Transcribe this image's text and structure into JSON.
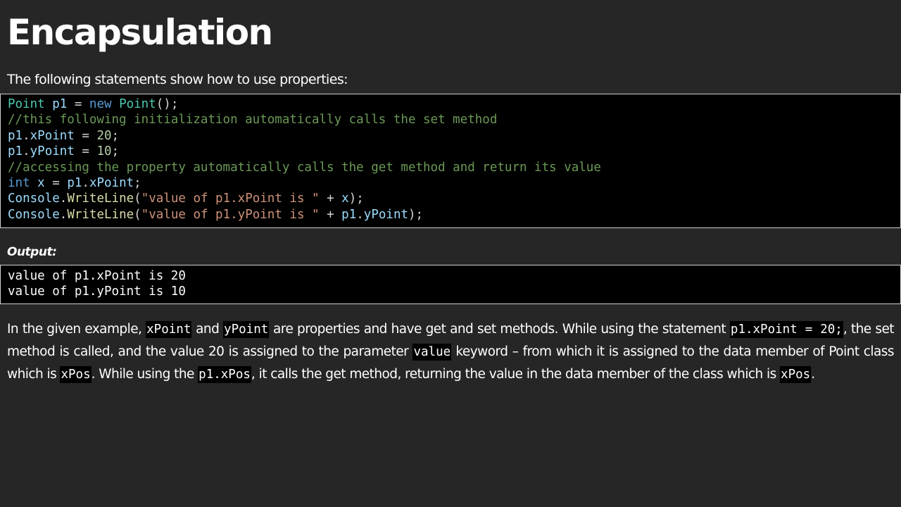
{
  "title": "Encapsulation",
  "intro": "The following statements show how to use properties:",
  "code": {
    "lines": [
      [
        {
          "t": "Point",
          "c": "t-type"
        },
        {
          "t": " ",
          "c": "t-op"
        },
        {
          "t": "p1",
          "c": "t-var"
        },
        {
          "t": " = ",
          "c": "t-op"
        },
        {
          "t": "new",
          "c": "t-kw"
        },
        {
          "t": " ",
          "c": "t-op"
        },
        {
          "t": "Point",
          "c": "t-type"
        },
        {
          "t": "();",
          "c": "t-op"
        }
      ],
      [
        {
          "t": "//this following initialization automatically calls the set method",
          "c": "t-cm"
        }
      ],
      [
        {
          "t": "p1",
          "c": "t-var"
        },
        {
          "t": ".",
          "c": "t-op"
        },
        {
          "t": "xPoint",
          "c": "t-var"
        },
        {
          "t": " = ",
          "c": "t-op"
        },
        {
          "t": "20",
          "c": "t-num"
        },
        {
          "t": ";",
          "c": "t-op"
        }
      ],
      [
        {
          "t": "p1",
          "c": "t-var"
        },
        {
          "t": ".",
          "c": "t-op"
        },
        {
          "t": "yPoint",
          "c": "t-var"
        },
        {
          "t": " = ",
          "c": "t-op"
        },
        {
          "t": "10",
          "c": "t-num"
        },
        {
          "t": ";",
          "c": "t-op"
        }
      ],
      [
        {
          "t": "//accessing the property automatically calls the get method and return its value",
          "c": "t-cm"
        }
      ],
      [
        {
          "t": "int",
          "c": "t-kw"
        },
        {
          "t": " ",
          "c": "t-op"
        },
        {
          "t": "x",
          "c": "t-var"
        },
        {
          "t": " = ",
          "c": "t-op"
        },
        {
          "t": "p1",
          "c": "t-var"
        },
        {
          "t": ".",
          "c": "t-op"
        },
        {
          "t": "xPoint",
          "c": "t-var"
        },
        {
          "t": ";",
          "c": "t-op"
        }
      ],
      [
        {
          "t": "Console",
          "c": "t-var"
        },
        {
          "t": ".",
          "c": "t-op"
        },
        {
          "t": "WriteLine",
          "c": "t-fn"
        },
        {
          "t": "(",
          "c": "t-op"
        },
        {
          "t": "\"value of p1.xPoint is \"",
          "c": "t-str"
        },
        {
          "t": " + ",
          "c": "t-op"
        },
        {
          "t": "x",
          "c": "t-var"
        },
        {
          "t": ");",
          "c": "t-op"
        }
      ],
      [
        {
          "t": "Console",
          "c": "t-var"
        },
        {
          "t": ".",
          "c": "t-op"
        },
        {
          "t": "WriteLine",
          "c": "t-fn"
        },
        {
          "t": "(",
          "c": "t-op"
        },
        {
          "t": "\"value of p1.yPoint is \"",
          "c": "t-str"
        },
        {
          "t": " + ",
          "c": "t-op"
        },
        {
          "t": "p1",
          "c": "t-var"
        },
        {
          "t": ".",
          "c": "t-op"
        },
        {
          "t": "yPoint",
          "c": "t-var"
        },
        {
          "t": ");",
          "c": "t-op"
        }
      ]
    ]
  },
  "output_label": "Output:",
  "output_lines": [
    "value of p1.xPoint is 20",
    "value of p1.yPoint is 10"
  ],
  "paragraph": [
    {
      "t": "In the given example, ",
      "code": false
    },
    {
      "t": "xPoint",
      "code": true
    },
    {
      "t": " and ",
      "code": false
    },
    {
      "t": "yPoint",
      "code": true
    },
    {
      "t": " are properties and have get and set methods. While using the statement ",
      "code": false
    },
    {
      "t": "p1.xPoint = 20;",
      "code": true
    },
    {
      "t": ", the set method is called, and the value 20 is assigned to the parameter ",
      "code": false
    },
    {
      "t": "value",
      "code": true
    },
    {
      "t": " keyword – from which it is assigned to the data member of Point class which is ",
      "code": false
    },
    {
      "t": "xPos",
      "code": true
    },
    {
      "t": ". While using the ",
      "code": false
    },
    {
      "t": "p1.xPos",
      "code": true
    },
    {
      "t": ", it calls the get method, returning the value in the data member of the class which is ",
      "code": false
    },
    {
      "t": "xPos",
      "code": true
    },
    {
      "t": ".",
      "code": false
    }
  ]
}
